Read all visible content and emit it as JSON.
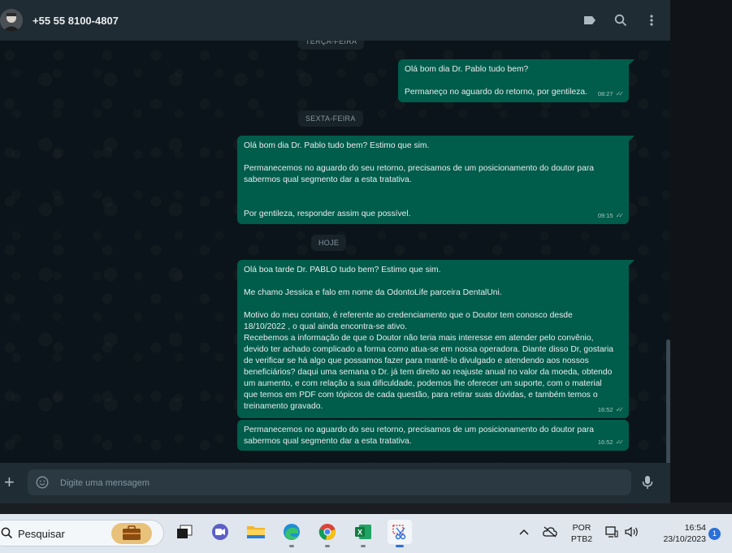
{
  "header": {
    "contact_name": "+55 55 8100-4807"
  },
  "chat": {
    "date_separators": {
      "tuesday": "TERÇA-FEIRA",
      "friday": "SEXTA-FEIRA",
      "today": "HOJE"
    },
    "messages": [
      {
        "text": "Olá bom dia Dr. Pablo tudo bem?\n\nPermaneço no aguardo do retorno, por gentileza.",
        "time": "08:27"
      },
      {
        "text": "Olá bom dia Dr. Pablo tudo bem? Estimo que sim.\n\nPermanecemos no aguardo do seu retorno, precisamos de um posicionamento do doutor para\nsabermos qual segmento dar a esta tratativa.\n\n\nPor gentileza, responder assim que possível.",
        "time": "09:15"
      },
      {
        "text": "Olá boa tarde Dr. PABLO tudo bem? Estimo que sim.\n\nMe chamo Jessica e falo em nome da OdontoLife parceira DentalUni.\n\nMotivo do meu contato, é referente ao credenciamento que o Doutor tem conosco desde\n18/10/2022 , o qual ainda encontra-se ativo.\nRecebemos a informação de que o Doutor não teria mais interesse em atender pelo convênio,\ndevido ter achado complicado a forma como atua-se em nossa operadora. Diante disso Dr, gostaria\nde verificar se há algo que possamos fazer para mantê-lo divulgado e atendendo aos nossos\nbeneficiários? daqui uma semana o Dr. já tem direito ao reajuste anual no valor da moeda, obtendo\num aumento, e com relação a sua dificuldade, podemos lhe oferecer um suporte, com o material\nque temos em PDF com tópicos de cada questão, para retirar suas dúvidas, e também temos o\ntreinamento gravado.",
        "time": "16:52"
      },
      {
        "text": "Permanecemos no aguardo do seu retorno, precisamos de um posicionamento do doutor para\nsabermos qual segmento dar a esta tratativa.",
        "time": "16:52"
      }
    ]
  },
  "composer": {
    "placeholder": "Digite uma mensagem"
  },
  "taskbar": {
    "search_placeholder": "Pesquisar",
    "language_line1": "POR",
    "language_line2": "PTB2",
    "time": "16:54",
    "date": "23/10/2023",
    "notification_count": "1"
  },
  "colors": {
    "bubble_outgoing": "#005c4b",
    "chat_background": "#0b141a",
    "header_background": "#202c33"
  }
}
